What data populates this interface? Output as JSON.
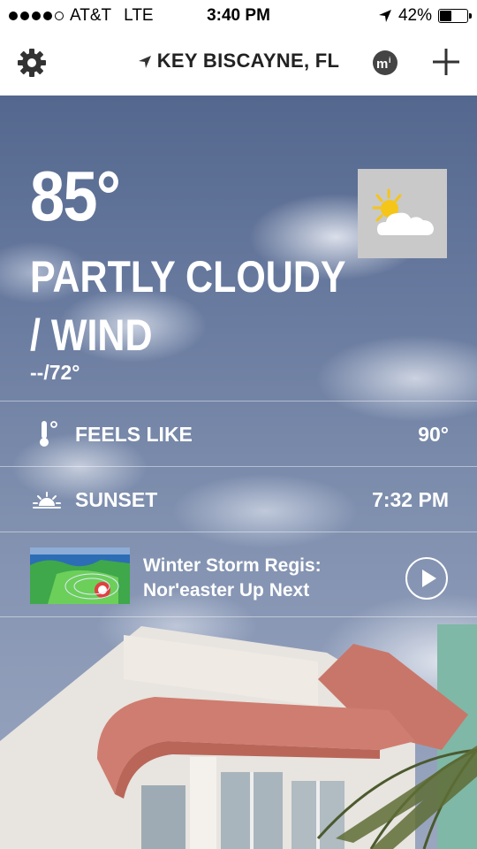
{
  "status_bar": {
    "carrier": "AT&T",
    "network": "LTE",
    "time": "3:40 PM",
    "battery_text": "42%",
    "battery_level": 0.42,
    "signal_bars_filled": 4,
    "signal_bars_total": 5,
    "icons": [
      "location-arrow-icon",
      "battery-icon"
    ]
  },
  "header": {
    "location": "KEY BISCAYNE, FL",
    "icons": [
      "gear-icon",
      "location-arrow-icon",
      "mi-icon",
      "plus-icon"
    ]
  },
  "current": {
    "temperature": "85°",
    "condition": "PARTLY CLOUDY / WIND",
    "hi_lo": "--/72°",
    "condition_icon": "partly-sunny-icon"
  },
  "details": [
    {
      "label": "FEELS LIKE",
      "value": "90°",
      "icon": "thermometer-icon"
    },
    {
      "label": "SUNSET",
      "value": "7:32 PM",
      "icon": "sunset-icon"
    }
  ],
  "video": {
    "title": "Winter Storm Regis: Nor'easter Up Next",
    "icon": "play-icon"
  },
  "colors": {
    "text": "#ffffff",
    "header_bg": "#ffffff",
    "header_text": "#222222",
    "condition_icon_bg": "#c9c9c9",
    "sun": "#f5c518"
  }
}
